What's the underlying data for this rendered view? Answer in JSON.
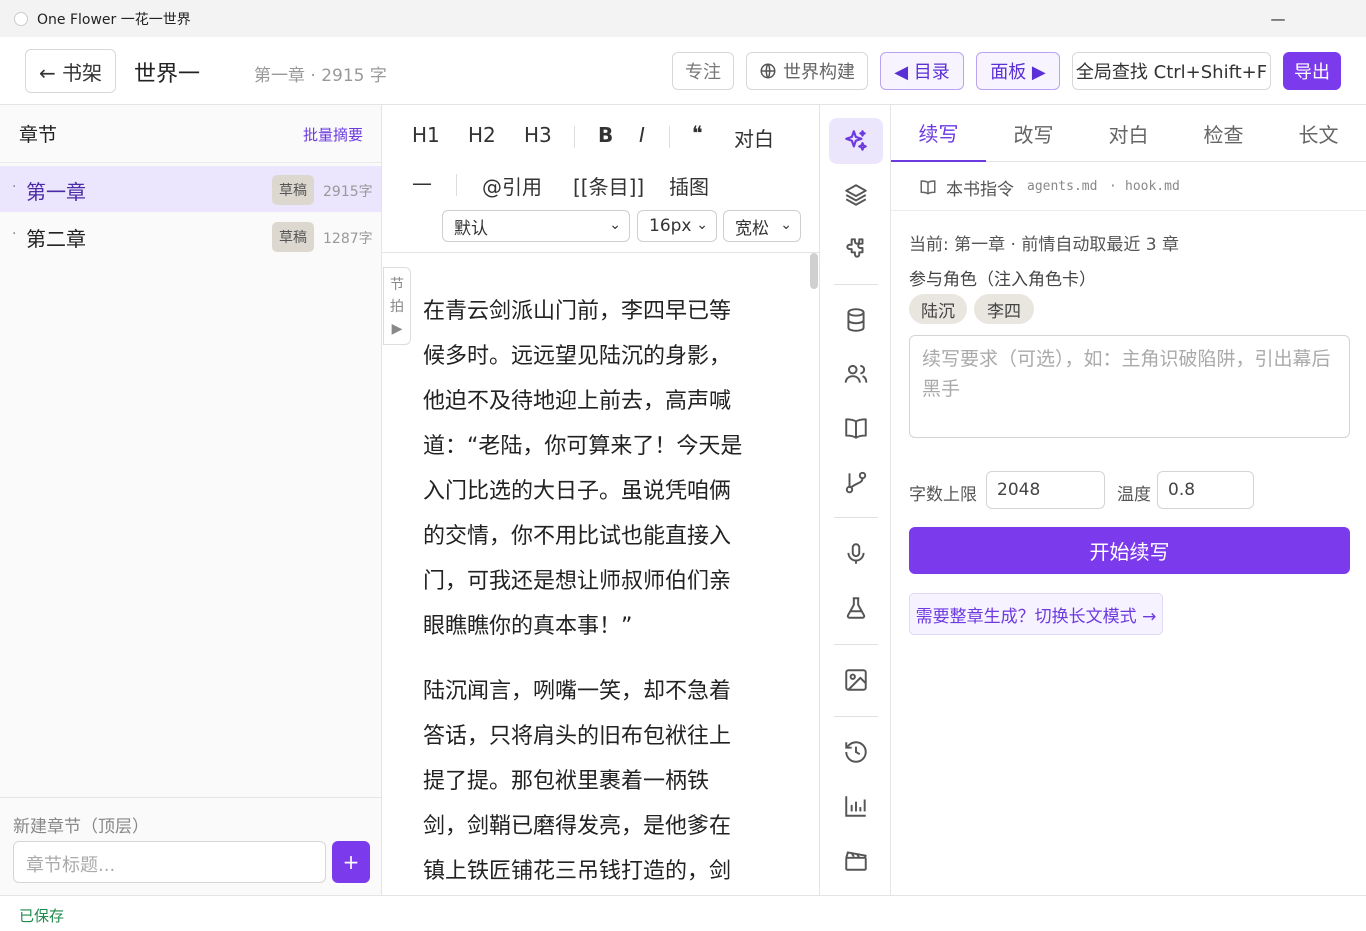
{
  "window": {
    "title": "One Flower 一花一世界"
  },
  "header": {
    "back_label": "← 书架",
    "book_title": "世界一",
    "chapter_info": "第一章 · 2915 字",
    "focus_label": "专注",
    "world_label": "世界构建",
    "toc_label": "◀ 目录",
    "panel_label": "面板 ▶",
    "search_label": "全局查找 Ctrl+Shift+F",
    "export_label": "导出"
  },
  "sidebar": {
    "title": "章节",
    "batch_summary": "批量摘要",
    "chapters": [
      {
        "dot": "·",
        "name": "第一章",
        "status": "草稿",
        "count": "2915字"
      },
      {
        "dot": "·",
        "name": "第二章",
        "status": "草稿",
        "count": "1287字"
      }
    ],
    "new_chapter_label": "新建章节（顶层）",
    "new_chapter_placeholder": "章节标题...",
    "add_label": "+"
  },
  "editor_toolbar": {
    "h1": "H1",
    "h2": "H2",
    "h3": "H3",
    "bold": "B",
    "italic": "I",
    "quote": "❝",
    "dialogue": "对白",
    "hr": "—",
    "cite": "@引用",
    "entry": "[[条目]]",
    "illustration": "插图",
    "font_value": "默认",
    "size_value": "16px",
    "spacing_value": "宽松"
  },
  "editor": {
    "beat_tab": [
      "节",
      "拍",
      "▶"
    ],
    "paragraph_1_lines": [
      "在青云剑派山门前，李四早已等",
      "候多时。远远望见陆沉的身影，",
      "他迫不及待地迎上前去，高声喊",
      "道：“老陆，你可算来了！今天是",
      "入门比选的大日子。虽说凭咱俩",
      "的交情，你不用比试也能直接入",
      "门，可我还是想让师叔师伯们亲",
      "眼瞧瞧你的真本事！”"
    ],
    "paragraph_2_lines": [
      "陆沉闻言，咧嘴一笑，却不急着",
      "答话，只将肩头的旧布包袱往上",
      "提了提。那包袱里裹着一柄铁",
      "剑，剑鞘已磨得发亮，是他爹在",
      "镇上铁匠铺花三吊钱打造的，剑"
    ]
  },
  "panel": {
    "tabs": [
      "续写",
      "改写",
      "对白",
      "检查",
      "长文"
    ],
    "instructions_label": "本书指令",
    "instruction_files": [
      "agents.md",
      "·",
      "hook.md"
    ],
    "current_text": "当前: 第一章 · 前情自动取最近 3 章",
    "characters_label": "参与角色（注入角色卡）",
    "characters": [
      "陆沉",
      "李四"
    ],
    "requirement_placeholder": "续写要求（可选），如：主角识破陷阱，引出幕后黑手",
    "word_limit_label": "字数上限",
    "word_limit_value": "2048",
    "temperature_label": "温度",
    "temperature_value": "0.8",
    "start_button": "开始续写",
    "long_mode_link": "需要整章生成？切换长文模式 →"
  },
  "status": {
    "saved": "已保存"
  },
  "colors": {
    "accent": "#7c3aed",
    "saved": "#1f8a4c"
  }
}
